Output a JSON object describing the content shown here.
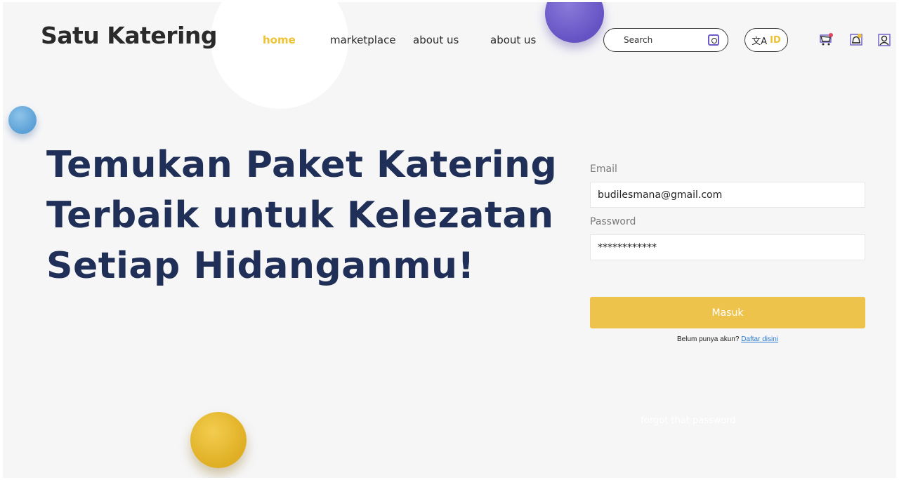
{
  "header": {
    "logo": "Satu Katering",
    "nav": [
      {
        "label": "home",
        "active": true
      },
      {
        "label": "marketplace",
        "active": false
      },
      {
        "label": "about us",
        "active": false
      },
      {
        "label": "about us",
        "active": false
      }
    ],
    "search": {
      "placeholder": "Search",
      "value": ""
    },
    "language": {
      "label": "ID",
      "icon": "translate-icon"
    },
    "icons": [
      "cart-icon",
      "bell-icon",
      "profile-icon"
    ]
  },
  "hero": {
    "line1": "Temukan Paket Katering",
    "line2": "Terbaik untuk Kelezatan",
    "line3": "Setiap Hidanganmu!"
  },
  "login": {
    "email_label": "Email",
    "email_value": "budilesmana@gmail.com",
    "password_label": "Password",
    "password_value": "************",
    "submit_label": "Masuk",
    "signup_prompt": "Belum punya akun?",
    "signup_link": "Daftar disini",
    "forgot_link": "forgot that password"
  },
  "colors": {
    "accent": "#efc233",
    "navy": "#1f2f58",
    "button": "#edc34b",
    "link": "#2b7bd4"
  }
}
